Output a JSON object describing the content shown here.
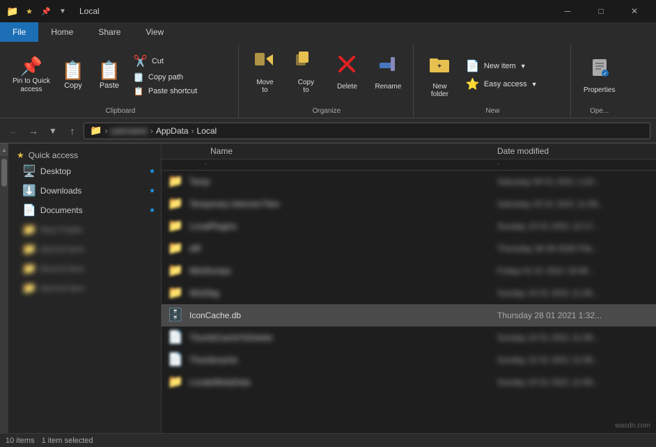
{
  "titleBar": {
    "title": "Local"
  },
  "ribbonTabs": [
    {
      "label": "File",
      "active": true
    },
    {
      "label": "Home",
      "active": false
    },
    {
      "label": "Share",
      "active": false
    },
    {
      "label": "View",
      "active": false
    }
  ],
  "clipboard": {
    "label": "Clipboard",
    "pinToQuickAccess": "Pin to Quick\naccess",
    "copy": "Copy",
    "paste": "Paste",
    "cut": "Cut",
    "copyPath": "Copy path",
    "pasteShortcut": "Paste shortcut"
  },
  "organize": {
    "label": "Organize",
    "moveTo": "Move\nto",
    "copyTo": "Copy\nto",
    "delete": "Delete",
    "rename": "Rename",
    "newFolder": "New\nfolder"
  },
  "newGroup": {
    "label": "New",
    "newItem": "New item",
    "easyAccess": "Easy access"
  },
  "openGroup": {
    "label": "Ope...",
    "properties": "Properties"
  },
  "addressBar": {
    "path": [
      "AppData",
      "Local"
    ],
    "currentFolder": "Local"
  },
  "sidebar": {
    "quickAccessLabel": "Quick access",
    "items": [
      {
        "label": "Desktop",
        "icon": "🖥️",
        "pinned": true,
        "blurred": false
      },
      {
        "label": "Downloads",
        "icon": "⬇️",
        "pinned": true,
        "blurred": false
      },
      {
        "label": "Documents",
        "icon": "📄",
        "pinned": true,
        "blurred": false
      },
      {
        "label": "New folder",
        "icon": "📁",
        "pinned": false,
        "blurred": true
      },
      {
        "label": "blurred item 1",
        "icon": "📁",
        "pinned": false,
        "blurred": true
      },
      {
        "label": "blurred item 2",
        "icon": "📁",
        "pinned": false,
        "blurred": true
      },
      {
        "label": "blurred item 3",
        "icon": "📁",
        "pinned": false,
        "blurred": true
      }
    ]
  },
  "fileList": {
    "colName": "Name",
    "colDate": "Date modified",
    "sortIndicator": "-",
    "files": [
      {
        "name": "Temp",
        "icon": "📁",
        "date": "Saturday 09 01 2021 1:03...",
        "blurred": true,
        "selected": false
      },
      {
        "name": "Temporary Internet Files",
        "icon": "📁",
        "date": "Saturday 23 01 2021 11:08...",
        "blurred": true,
        "selected": false
      },
      {
        "name": "LocalPlugins",
        "icon": "📁",
        "date": "Sunday 10 01 2021 12:17...",
        "blurred": true,
        "selected": false
      },
      {
        "name": "diff",
        "icon": "📁",
        "date": "Thursday 26 09 2020 File...",
        "blurred": true,
        "selected": false
      },
      {
        "name": "MiniDumps",
        "icon": "📁",
        "date": "Friday 01 01 2021 19:06...",
        "blurred": true,
        "selected": false
      },
      {
        "name": "WinDbg",
        "icon": "📁",
        "date": "Sunday 10 01 2021 11:05...",
        "blurred": true,
        "selected": false
      },
      {
        "name": "IconCache.db",
        "icon": "🗄️",
        "date": "Thursday 28 01 2021 1:32...",
        "blurred": false,
        "selected": true
      },
      {
        "name": "ThumbCacheToDelete",
        "icon": "📄",
        "date": "Sunday 10 01 2021 11:09...",
        "blurred": true,
        "selected": false
      },
      {
        "name": "Thumbcache",
        "icon": "📄",
        "date": "Sunday 10 01 2021 11:09...",
        "blurred": true,
        "selected": false
      },
      {
        "name": "LocaleMetaData",
        "icon": "📁",
        "date": "Sunday 10 01 2021 11:09...",
        "blurred": true,
        "selected": false
      }
    ]
  },
  "statusBar": {
    "itemCount": "10 items",
    "selectedText": "1 item selected"
  },
  "watermark": "wasdn.com"
}
